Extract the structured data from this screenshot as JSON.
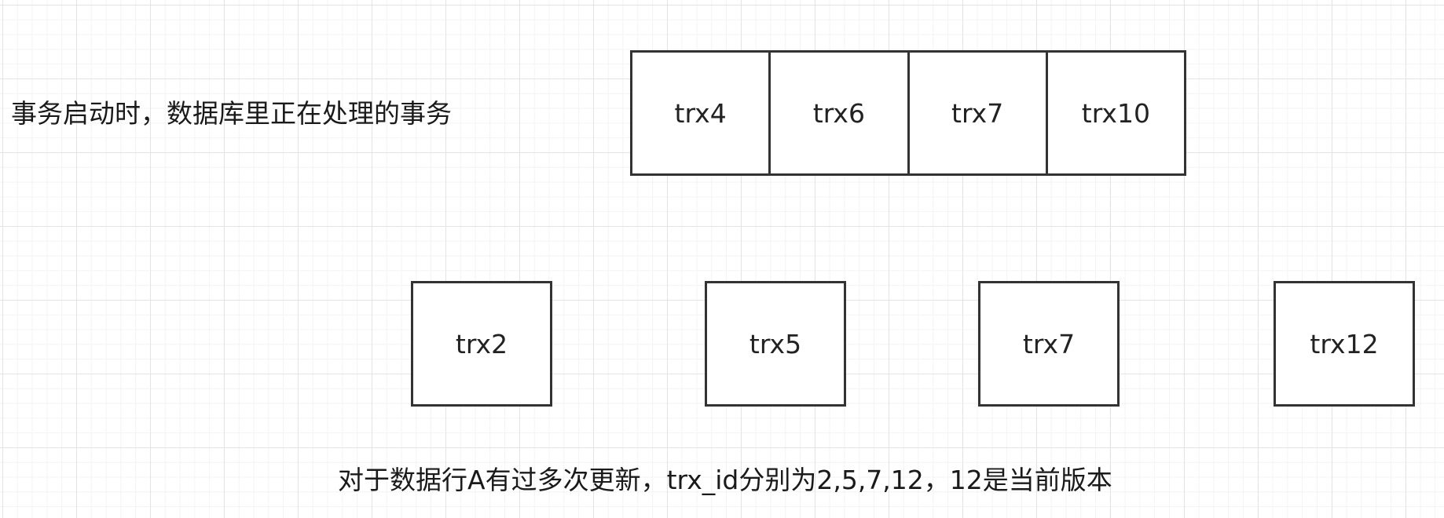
{
  "labels": {
    "active_transactions": "事务启动时，数据库里正在处理的事务",
    "row_history": "对于数据行A有过多次更新，trx_id分别为2,5,7,12，12是当前版本"
  },
  "active_transactions": [
    "trx4",
    "trx6",
    "trx7",
    "trx10"
  ],
  "row_versions": [
    "trx2",
    "trx5",
    "trx7",
    "trx12"
  ],
  "colors": {
    "border": "#333333",
    "text": "#1a1a1a",
    "grid": "#e4e4e4",
    "background": "#ffffff"
  }
}
